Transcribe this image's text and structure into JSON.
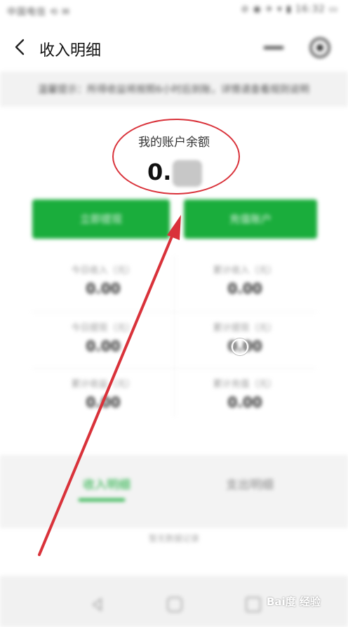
{
  "statusbar": {
    "left": "中国电信 ⟲ ✉",
    "right": "⊘ ◉ ✈ ▾ ▮ 16:32 ▭"
  },
  "header": {
    "title": "收入明细"
  },
  "notice": {
    "text": "温馨提示：所得收益将按照6小时后到账，详情请查看规则说明"
  },
  "balance": {
    "label": "我的账户余额",
    "value": "0."
  },
  "buttons": {
    "left": "立即提现",
    "right": "充值账户"
  },
  "stats": [
    {
      "label": "今日收入（元）",
      "value": "0.00"
    },
    {
      "label": "累计收入（元）",
      "value": "0.00"
    },
    {
      "label": "今日提现（元）",
      "value": "0.00"
    },
    {
      "label": "累计提现（元）",
      "value": "0.00"
    },
    {
      "label": "累计收益（元）",
      "value": "0.00"
    },
    {
      "label": "累计充值（元）",
      "value": "0.00"
    }
  ],
  "tabs": {
    "active": "收入明细",
    "inactive": "支出明细"
  },
  "list": {
    "empty": "暂无数据记录"
  },
  "watermark": "Bai度 经验",
  "colors": {
    "accent": "#1aad3c",
    "annotation": "#d9323a"
  }
}
